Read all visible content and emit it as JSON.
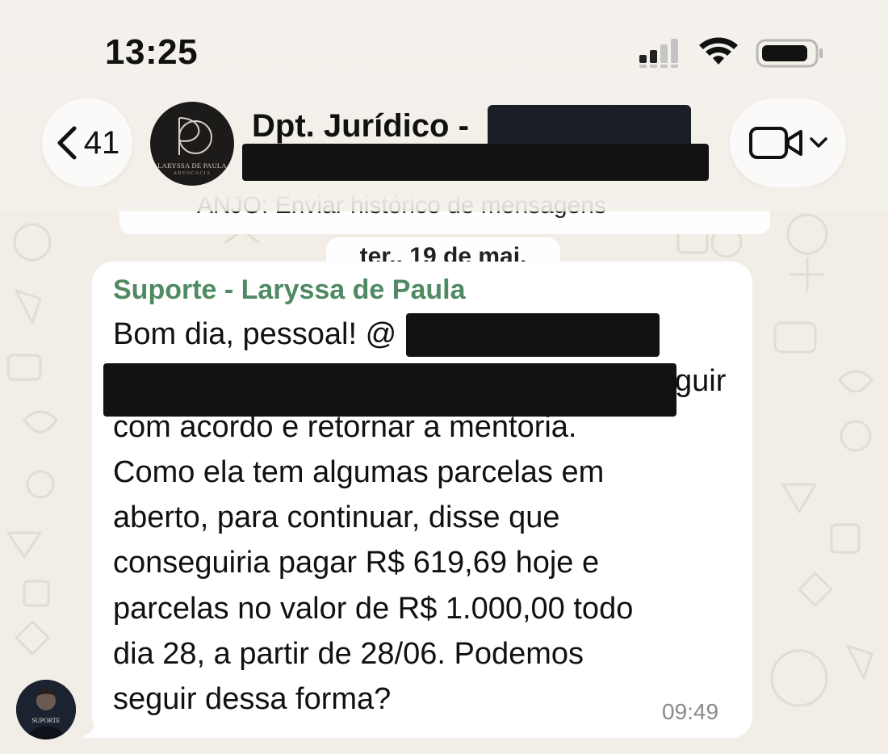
{
  "status_bar": {
    "time": "13:25",
    "icons": [
      "cellular-signal-icon",
      "wifi-icon",
      "battery-icon"
    ]
  },
  "header": {
    "back_count": "41",
    "group_title": "Dpt. Jurídico - ",
    "group_avatar_text": "LARYSSA DE PAULA",
    "group_avatar_subtext": "ADVOCACIA",
    "video_call_icon": "video-camera-icon"
  },
  "previous_message_text": "ANJO: Enviar histórico de mensagens",
  "date_separator": "ter., 19 de mai.",
  "message": {
    "sender": "Suporte - Laryssa de Paula",
    "lines": [
      "Bom dia, pessoal! @",
      "guir",
      "com acordo e retornar a mentoria.",
      "Como ela tem algumas parcelas em",
      "aberto, para continuar, disse que",
      "conseguiria pagar R$ 619,69 hoje e",
      "parcelas no valor de R$ 1.000,00 todo",
      "dia 28, a partir de 28/06. Podemos",
      "seguir dessa forma?"
    ],
    "time": "09:49",
    "sender_avatar_label": "SUPORTE"
  },
  "colors": {
    "background": "#f2eee7",
    "bubble": "#ffffff",
    "sender_name": "#4f8a62",
    "redaction": "#121212"
  }
}
